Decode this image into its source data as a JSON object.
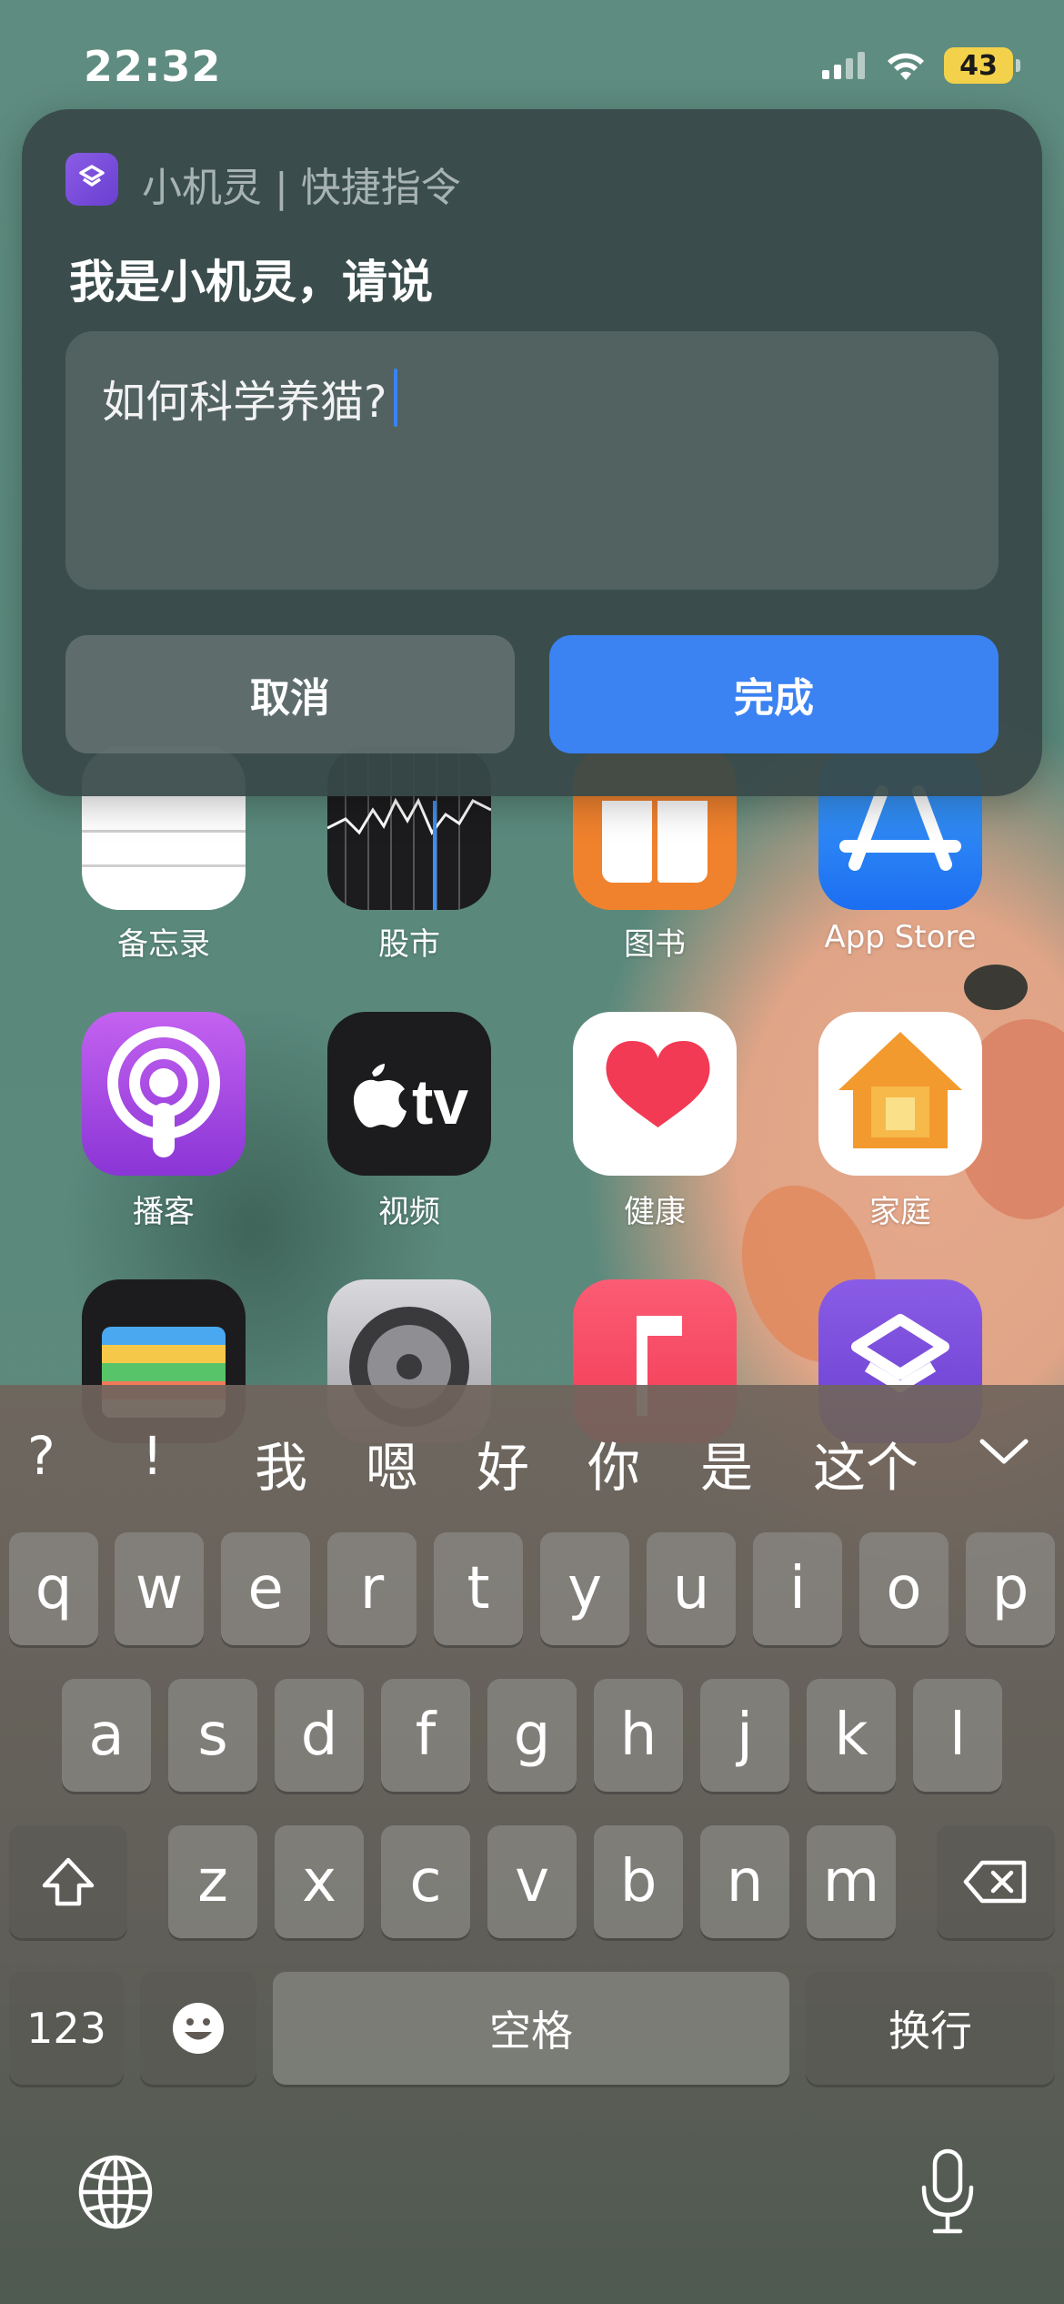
{
  "status_bar": {
    "time": "22:32",
    "battery": "43"
  },
  "dialog": {
    "app_name": "小机灵 | 快捷指令",
    "prompt": "我是小机灵，请说",
    "input_value": "如何科学养猫?",
    "cancel_label": "取消",
    "done_label": "完成"
  },
  "home_apps": [
    {
      "label": "备忘录",
      "icon": "notes-icon"
    },
    {
      "label": "股市",
      "icon": "stocks-icon"
    },
    {
      "label": "图书",
      "icon": "books-icon"
    },
    {
      "label": "App Store",
      "icon": "app-store-icon"
    },
    {
      "label": "播客",
      "icon": "podcasts-icon"
    },
    {
      "label": "视频",
      "icon": "apple-tv-icon"
    },
    {
      "label": "健康",
      "icon": "health-icon"
    },
    {
      "label": "家庭",
      "icon": "home-icon"
    },
    {
      "label": "",
      "icon": "wallet-icon"
    },
    {
      "label": "",
      "icon": "settings-icon"
    },
    {
      "label": "",
      "icon": "music-icon"
    },
    {
      "label": "",
      "icon": "shortcuts-icon"
    }
  ],
  "keyboard": {
    "candidates": [
      "?",
      "!",
      "我",
      "嗯",
      "好",
      "你",
      "是",
      "这个"
    ],
    "row1": [
      "q",
      "w",
      "e",
      "r",
      "t",
      "y",
      "u",
      "i",
      "o",
      "p"
    ],
    "row2": [
      "a",
      "s",
      "d",
      "f",
      "g",
      "h",
      "j",
      "k",
      "l"
    ],
    "row3": [
      "z",
      "x",
      "c",
      "v",
      "b",
      "n",
      "m"
    ],
    "numbers_label": "123",
    "space_label": "空格",
    "return_label": "换行"
  },
  "colors": {
    "accent": "#3b82f2",
    "battery": "#f3d14a"
  }
}
